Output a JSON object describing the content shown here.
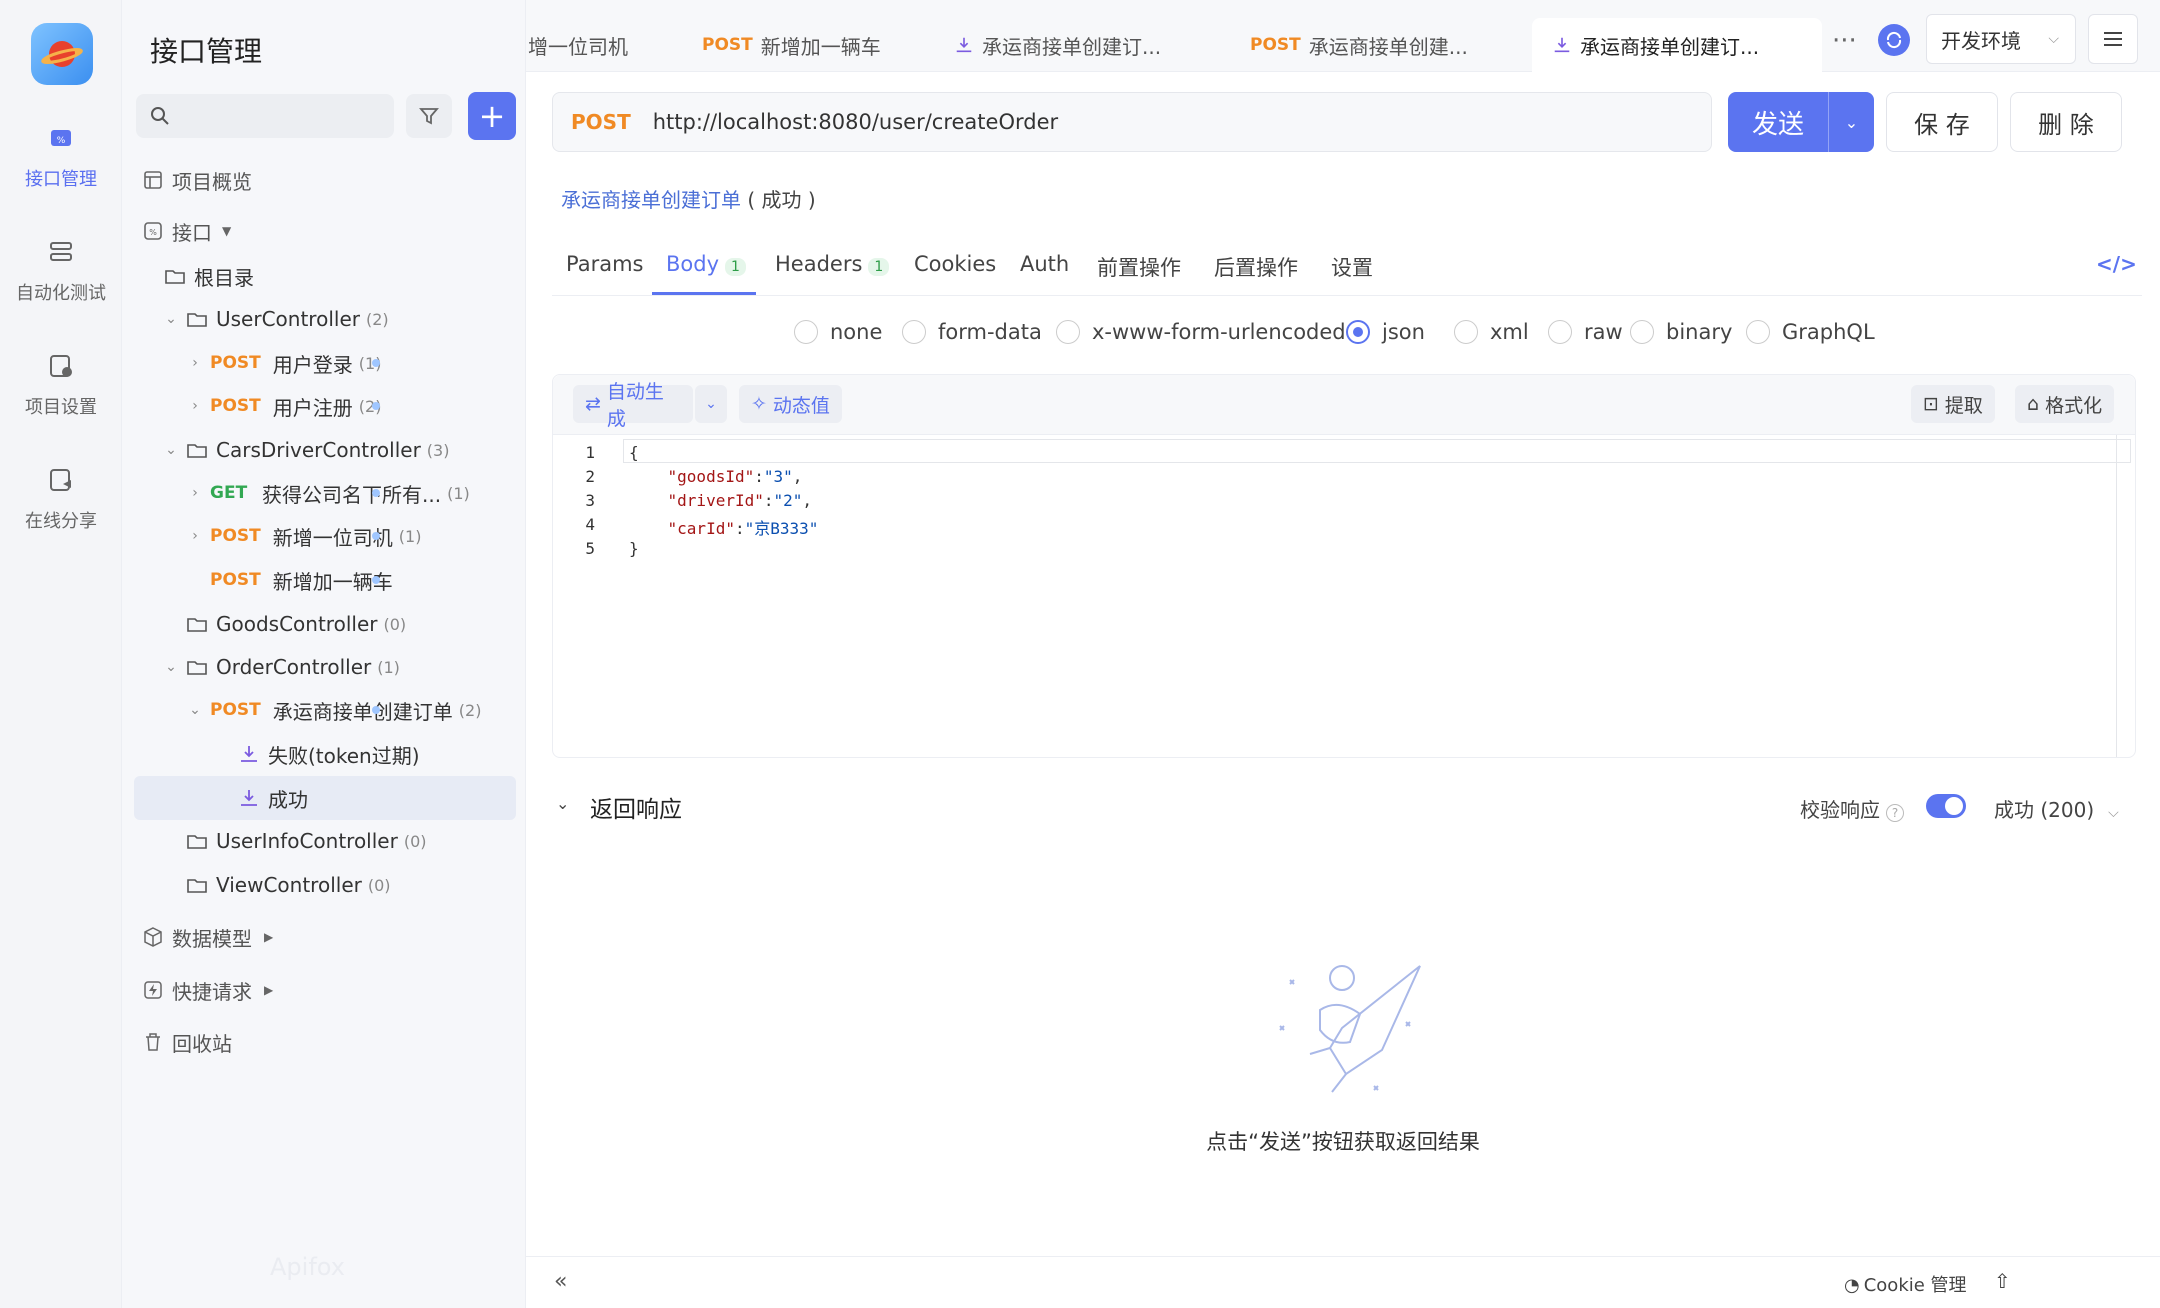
{
  "rail": {
    "items": [
      {
        "label": "接口管理",
        "icon": "api-icon"
      },
      {
        "label": "自动化测试",
        "icon": "automation-icon"
      },
      {
        "label": "项目设置",
        "icon": "settings-icon"
      },
      {
        "label": "在线分享",
        "icon": "share-icon"
      }
    ]
  },
  "tree": {
    "title": "接口管理",
    "search_placeholder": "",
    "overview": "项目概览",
    "api_label": "接口",
    "root": "根目录",
    "nodes": [
      {
        "name": "UserController",
        "count": "(2)"
      },
      {
        "method": "POST",
        "name": "用户登录",
        "count": "(1)"
      },
      {
        "method": "POST",
        "name": "用户注册",
        "count": "(2)"
      },
      {
        "name": "CarsDriverController",
        "count": "(3)"
      },
      {
        "method": "GET",
        "name": "获得公司名下所有...",
        "count": "(1)"
      },
      {
        "method": "POST",
        "name": "新增一位司机",
        "count": "(1)"
      },
      {
        "method": "POST",
        "name": "新增加一辆车",
        "count": ""
      },
      {
        "name": "GoodsController",
        "count": "(0)"
      },
      {
        "name": "OrderController",
        "count": "(1)"
      },
      {
        "method": "POST",
        "name": "承运商接单创建订单",
        "count": "(2)"
      },
      {
        "name": "失败(token过期)"
      },
      {
        "name": "成功"
      },
      {
        "name": "UserInfoController",
        "count": "(0)"
      },
      {
        "name": "ViewController",
        "count": "(0)"
      }
    ],
    "data_model": "数据模型",
    "quick_request": "快捷请求",
    "recycle": "回收站",
    "watermark": "Apifox"
  },
  "tabs": [
    {
      "method": "",
      "label": "增一位司机"
    },
    {
      "method": "POST",
      "label": "新增加一辆车"
    },
    {
      "method": "",
      "label": "承运商接单创建订..."
    },
    {
      "method": "POST",
      "label": "承运商接单创建..."
    },
    {
      "method": "",
      "label": "承运商接单创建订..."
    }
  ],
  "tabs_more": "···",
  "env": "开发环境",
  "request": {
    "method": "POST",
    "url": "http://localhost:8080/user/createOrder",
    "send": "发送",
    "save": "保 存",
    "delete": "删 除"
  },
  "crumb": {
    "link": "承运商接单创建订单",
    "state": "( 成功 )"
  },
  "subtabs": [
    {
      "label": "Params",
      "badge": ""
    },
    {
      "label": "Body",
      "badge": "1"
    },
    {
      "label": "Headers",
      "badge": "1"
    },
    {
      "label": "Cookies",
      "badge": ""
    },
    {
      "label": "Auth",
      "badge": ""
    },
    {
      "label": "前置操作",
      "badge": ""
    },
    {
      "label": "后置操作",
      "badge": ""
    },
    {
      "label": "设置",
      "badge": ""
    }
  ],
  "body_types": [
    "none",
    "form-data",
    "x-www-form-urlencoded",
    "json",
    "xml",
    "raw",
    "binary",
    "GraphQL"
  ],
  "body_selected": "json",
  "editor": {
    "auto_gen": "自动生成",
    "dynamic": "动态值",
    "extract": "提取",
    "format": "格式化",
    "lines": [
      "1",
      "2",
      "3",
      "4",
      "5"
    ]
  },
  "json_body": {
    "goodsId": "3",
    "driverId": "2",
    "carId": "京B333"
  },
  "response": {
    "title": "返回响应",
    "verify": "校验响应",
    "status": "成功 (200)",
    "empty": "点击“发送”按钮获取返回结果"
  },
  "footer": {
    "cookie": "Cookie 管理"
  },
  "colors": {
    "accent": "#5b74f0",
    "post": "#f08a24",
    "get": "#32a852"
  }
}
